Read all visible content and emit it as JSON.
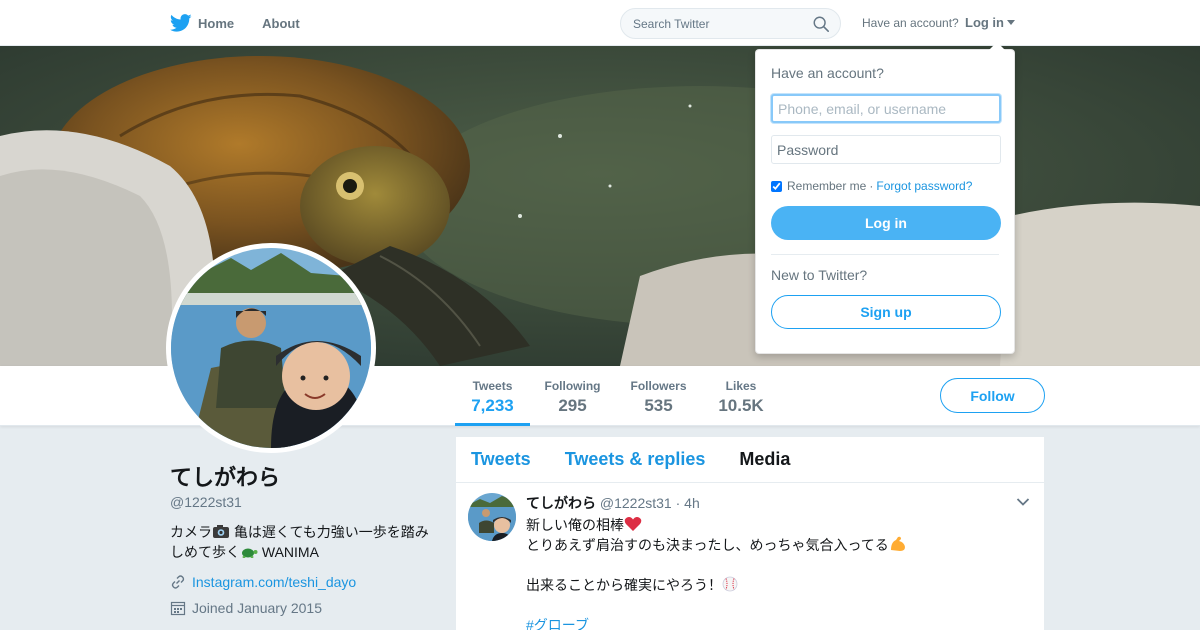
{
  "colors": {
    "accent": "#1da1f2",
    "link": "#1b95e0",
    "text_muted": "#657786",
    "background": "#e6ecf0",
    "heart": "#e0245e"
  },
  "topnav": {
    "home_label": "Home",
    "about_label": "About",
    "search_placeholder": "Search Twitter",
    "have_account_label": "Have an account?",
    "login_label": "Log in"
  },
  "login_dropdown": {
    "title": "Have an account?",
    "username_placeholder": "Phone, email, or username",
    "password_placeholder": "Password",
    "remember_label": "Remember me",
    "separator": "·",
    "forgot_label": "Forgot password?",
    "login_button": "Log in",
    "new_label": "New to Twitter?",
    "signup_button": "Sign up"
  },
  "profile_nav": {
    "stats": [
      {
        "label": "Tweets",
        "value": "7,233"
      },
      {
        "label": "Following",
        "value": "295"
      },
      {
        "label": "Followers",
        "value": "535"
      },
      {
        "label": "Likes",
        "value": "10.5K"
      }
    ],
    "follow_button": "Follow"
  },
  "profile": {
    "name": "てしがわら",
    "handle": "@1222st31",
    "bio_part1": "カメラ",
    "bio_part2": "亀は遅くても力強い一歩を踏みしめて歩く",
    "bio_part3": " WANIMA",
    "link": "Instagram.com/teshi_dayo",
    "joined": "Joined January 2015"
  },
  "timeline": {
    "tabs": [
      "Tweets",
      "Tweets & replies",
      "Media"
    ],
    "tweet": {
      "name": "てしがわら",
      "handle": "@1222st31",
      "dot": "·",
      "time": "4h",
      "line1": "新しい俺の相棒",
      "line2": "とりあえず肩治すのも決まったし、めっちゃ気合入ってる",
      "line3": "出来ることから確実にやろう！",
      "hashtag": "#グローブ"
    }
  }
}
